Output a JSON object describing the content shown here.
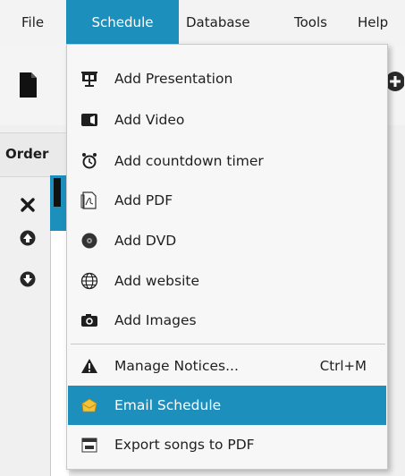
{
  "menubar": {
    "items": [
      {
        "label": "File"
      },
      {
        "label": "Schedule"
      },
      {
        "label": "Database"
      },
      {
        "label": "Tools"
      },
      {
        "label": "Help"
      }
    ],
    "active": "Schedule"
  },
  "panel": {
    "header": "Order"
  },
  "schedule_menu": {
    "items": [
      {
        "label": "Add Presentation",
        "icon": "presentation-icon"
      },
      {
        "label": "Add Video",
        "icon": "video-icon"
      },
      {
        "label": "Add countdown timer",
        "icon": "timer-icon"
      },
      {
        "label": "Add PDF",
        "icon": "pdf-icon"
      },
      {
        "label": "Add DVD",
        "icon": "dvd-icon"
      },
      {
        "label": "Add website",
        "icon": "globe-icon"
      },
      {
        "label": "Add Images",
        "icon": "camera-icon"
      },
      {
        "label": "Manage Notices...",
        "shortcut": "Ctrl+M",
        "icon": "warning-icon"
      },
      {
        "label": "Email Schedule",
        "icon": "email-icon"
      },
      {
        "label": "Export songs to PDF",
        "icon": "export-pdf-icon"
      }
    ],
    "highlighted": "Email Schedule"
  },
  "colors": {
    "accent": "#1d8fbd",
    "menu_bg": "#f7f7f7"
  }
}
